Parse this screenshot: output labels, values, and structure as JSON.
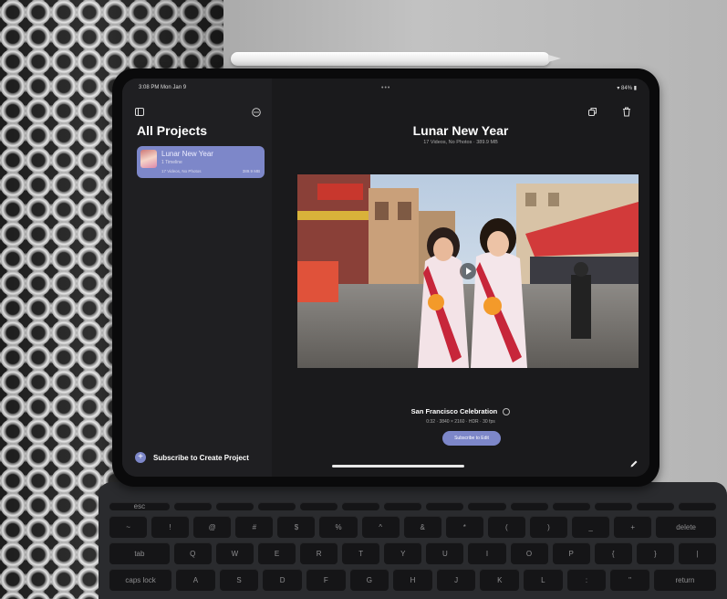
{
  "status_bar": {
    "time": "3:08 PM  Mon Jan 9",
    "dots": "•••",
    "battery": "▾ 84% ▮"
  },
  "sidebar": {
    "title": "All Projects",
    "projects": [
      {
        "name": "Lunar New Year",
        "subtitle": "1 Timeline",
        "meta": "17 Videos, No Photos",
        "size": "389.9 MB"
      }
    ],
    "subscribe_label": "Subscribe to Create Project"
  },
  "main": {
    "project_title": "Lunar New Year",
    "project_stats": "17 Videos, No Photos · 389.9 MB",
    "clip_title": "San Francisco Celebration",
    "clip_meta": "0:32 · 3840 × 2160 · HDR · 30 fps",
    "subscribe_edit_label": "Subscribe to Edit"
  },
  "colors": {
    "accent": "#7d87c9",
    "screen_bg": "#1a1a1c",
    "sidebar_bg": "#1f1f22"
  },
  "icons": [
    "sidebar-toggle-icon",
    "more-options-icon",
    "share-icon",
    "trash-icon",
    "play-icon",
    "info-icon",
    "plus-icon",
    "pencil-icon"
  ],
  "keyboard": {
    "row1": [
      "esc",
      "",
      "",
      "",
      "",
      "",
      "",
      "",
      "",
      "",
      "",
      "",
      "",
      ""
    ],
    "row2": [
      "~",
      "!",
      "@",
      "#",
      "$",
      "%",
      "^",
      "&",
      "*",
      "(",
      ")",
      "_",
      "+",
      "delete"
    ],
    "row3": [
      "tab",
      "Q",
      "W",
      "E",
      "R",
      "T",
      "Y",
      "U",
      "I",
      "O",
      "P",
      "{",
      "}",
      "|"
    ],
    "row4": [
      "caps lock",
      "A",
      "S",
      "D",
      "F",
      "G",
      "H",
      "J",
      "K",
      "L",
      ":",
      "\"",
      "return"
    ]
  }
}
